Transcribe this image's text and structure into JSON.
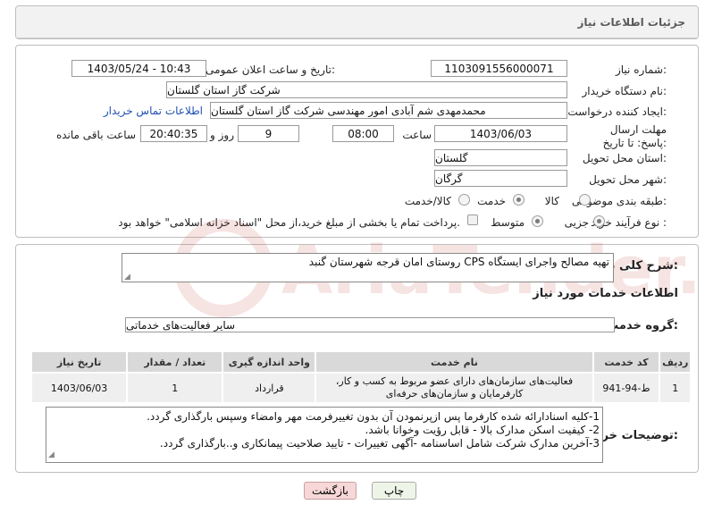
{
  "header": {
    "title": "جزئیات اطلاعات نیاز"
  },
  "fields": {
    "need_number_label": "شماره نیاز:",
    "need_number": "1103091556000071",
    "announce_label": "تاریخ و ساعت اعلان عمومی:",
    "announce_value": "1403/05/24 - 10:43",
    "buyer_label": "نام دستگاه خریدار:",
    "buyer": "شرکت گاز استان گلستان",
    "creator_label": "ایجاد کننده درخواست:",
    "creator": "محمدمهدی شم آبادی امور مهندسی شرکت گاز استان گلستان",
    "contact_link": "اطلاعات تماس خریدار",
    "deadline_label": "مهلت ارسال پاسخ: تا تاریخ:",
    "deadline_date": "1403/06/03",
    "time_label": "ساعت",
    "deadline_time": "08:00",
    "days": "9",
    "days_label": "روز و",
    "remaining_time": "20:40:35",
    "remaining_label": "ساعت باقی مانده",
    "province_label": "استان محل تحویل:",
    "province": "گلستان",
    "city_label": "شهر محل تحویل:",
    "city": "گرگان",
    "category_label": "طبقه بندی موضوعی:",
    "category_options": [
      "کالا",
      "خدمت",
      "کالا/خدمت"
    ],
    "category_selected": "خدمت",
    "process_label": "نوع فرآیند خرید :",
    "process_options": [
      "جزیی",
      "متوسط"
    ],
    "process_selected": "جزیی",
    "payment_note": "پرداخت تمام یا بخشی از مبلغ خرید،از محل \"اسناد خزانه اسلامی\" خواهد بود."
  },
  "summary": {
    "label": "شرح کلی نیاز:",
    "text": "تهیه مصالح واجرای ایستگاه CPS  روستای امان قرجه شهرستان گنبد"
  },
  "services": {
    "title": "اطلاعات خدمات مورد نیاز",
    "group_label": "گروه خدمت:",
    "group_value": "سایر فعالیت‌های خدماتی",
    "columns": [
      "ردیف",
      "کد خدمت",
      "نام خدمت",
      "واحد اندازه گیری",
      "تعداد / مقدار",
      "تاریخ نیاز"
    ],
    "rows": [
      {
        "index": "1",
        "code": "ط-94-941",
        "name_line1": "فعالیت‌های سازمان‌های دارای عضو مربوط به کسب و کار،",
        "name_line2": "کارفرمایان و سازمان‌های حرفه‌ای",
        "unit": "قرارداد",
        "qty": "1",
        "date": "1403/06/03"
      }
    ]
  },
  "buyer_notes": {
    "label": "توضیحات خریدار:",
    "lines": [
      "1-کلیه اسنادارائه شده کارفرما پس ازپرنمودن آن بدون تغییرفرمت مهر وامضاء وسپس بارگذاری گردد.",
      "2- کیفیت اسکن مدارک بالا - قابل رؤیت وخوانا باشد.",
      "3-آخرین مدارک شرکت شامل اساسنامه -آگهی تغییرات - تایید صلاحیت پیمانکاری و..بارگذاری گردد."
    ]
  },
  "buttons": {
    "print": "چاپ",
    "back": "بازگشت"
  },
  "watermark": {
    "text": "AriaTender.neT"
  },
  "colors": {
    "link": "#1f4fb0",
    "back_button_bg": "#f7d7d7",
    "print_button_bg": "#eaf3e2",
    "watermark": "#c0392b"
  }
}
